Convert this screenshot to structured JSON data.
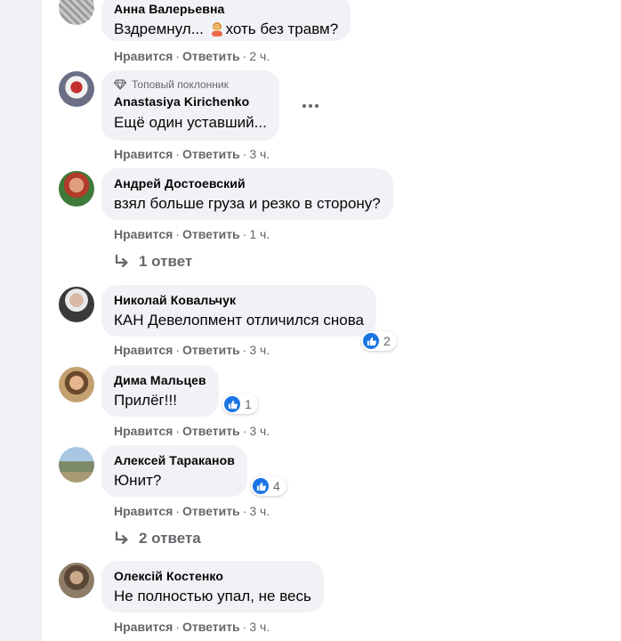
{
  "comments": [
    {
      "author": "Анна Валерьевна",
      "text_before": "Вздремнул... ",
      "emoji": "person-facepalming-emoji",
      "text_after": "хоть без травм?",
      "like": "Нравится",
      "reply": "Ответить",
      "time": "2 ч."
    },
    {
      "badge": "Топовый поклонник",
      "author": "Anastasiya Kirichenko",
      "text": "Ещё один уставший...",
      "like": "Нравится",
      "reply": "Ответить",
      "time": "3 ч."
    },
    {
      "author": "Андрей Достоевский",
      "text": "взял больше груза и резко в сторону?",
      "like": "Нравится",
      "reply": "Ответить",
      "time": "1 ч.",
      "replies": "1 ответ"
    },
    {
      "author": "Николай Ковальчук",
      "text": "КАН Девелопмент отличился снова",
      "like": "Нравится",
      "reply": "Ответить",
      "time": "3 ч.",
      "reactions": "2"
    },
    {
      "author": "Дима Мальцев",
      "text": "Прилёг!!!",
      "like": "Нравится",
      "reply": "Ответить",
      "time": "3 ч.",
      "reactions": "1"
    },
    {
      "author": "Алексей Тараканов",
      "text": "Юнит?",
      "like": "Нравится",
      "reply": "Ответить",
      "time": "3 ч.",
      "reactions": "4",
      "replies": "2 ответа"
    },
    {
      "author": "Олексій Костенко",
      "text": "Не полностью упал, не весь",
      "like": "Нравится",
      "reply": "Ответить",
      "time": "3 ч."
    }
  ],
  "separator": "·",
  "colors": {
    "bubble": "#f0f2f5",
    "text": "#050505",
    "secondary": "#65676b",
    "like_blue": "#1b74e4"
  },
  "icons": {
    "badge": "diamond-icon",
    "more": "more-options-icon",
    "reply_arrow": "reply-arrow-icon",
    "reaction": "like-thumb-icon"
  }
}
